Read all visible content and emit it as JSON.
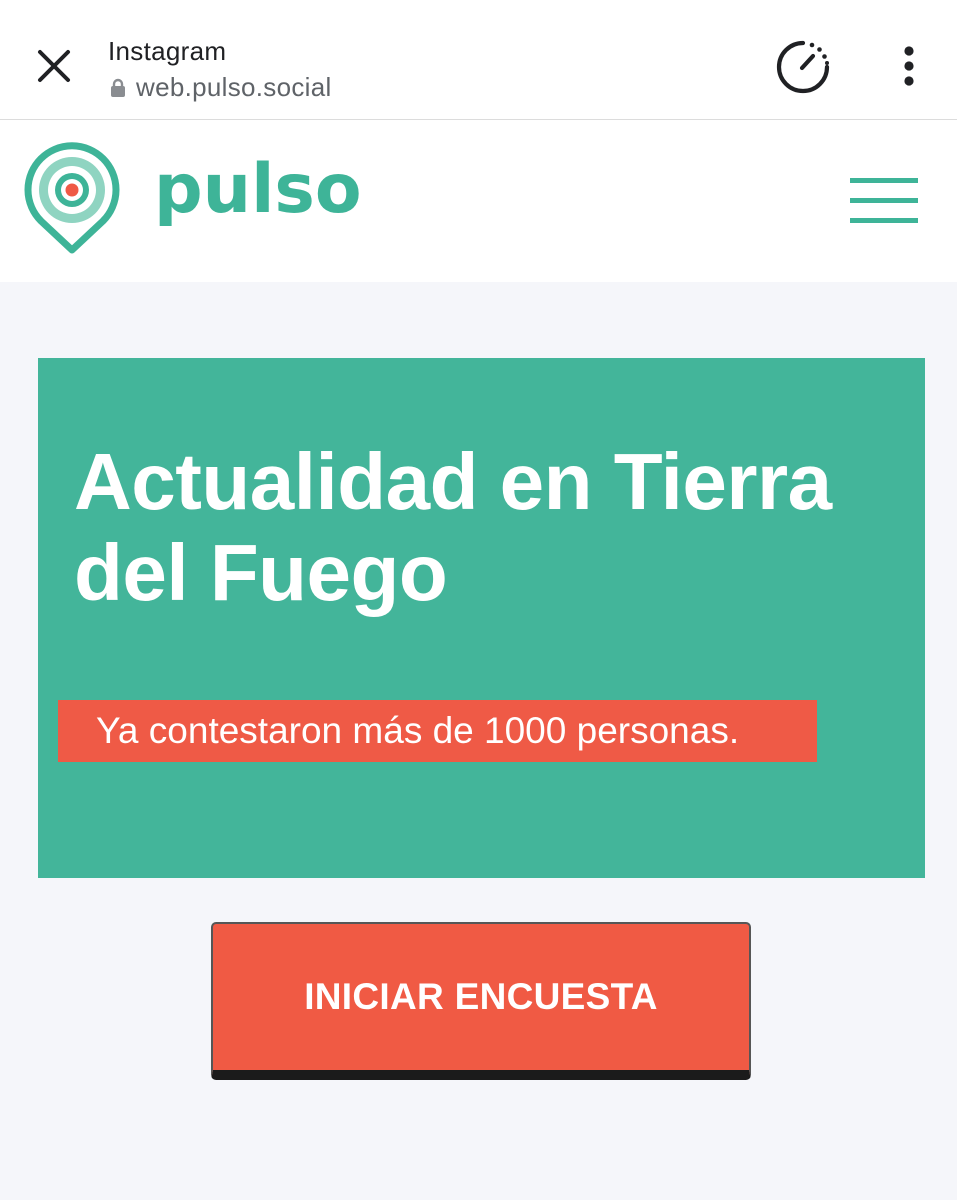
{
  "browser": {
    "title": "Instagram",
    "url": "web.pulso.social",
    "icons": {
      "close": "close-icon",
      "lock": "lock-icon",
      "timer": "timer-icon",
      "more": "more-vertical-icon"
    }
  },
  "site": {
    "logo_text": "pulso",
    "icons": {
      "logo": "location-pin-target-icon",
      "menu": "hamburger-menu-icon"
    }
  },
  "hero": {
    "title": "Actualidad en Tierra del Fuego",
    "badge": "Ya contestaron más de 1000 personas."
  },
  "cta": {
    "label": "INICIAR ENCUESTA"
  },
  "colors": {
    "brand_green": "#43b59a",
    "accent_red": "#ef5a46",
    "page_background": "#f5f6fa"
  }
}
